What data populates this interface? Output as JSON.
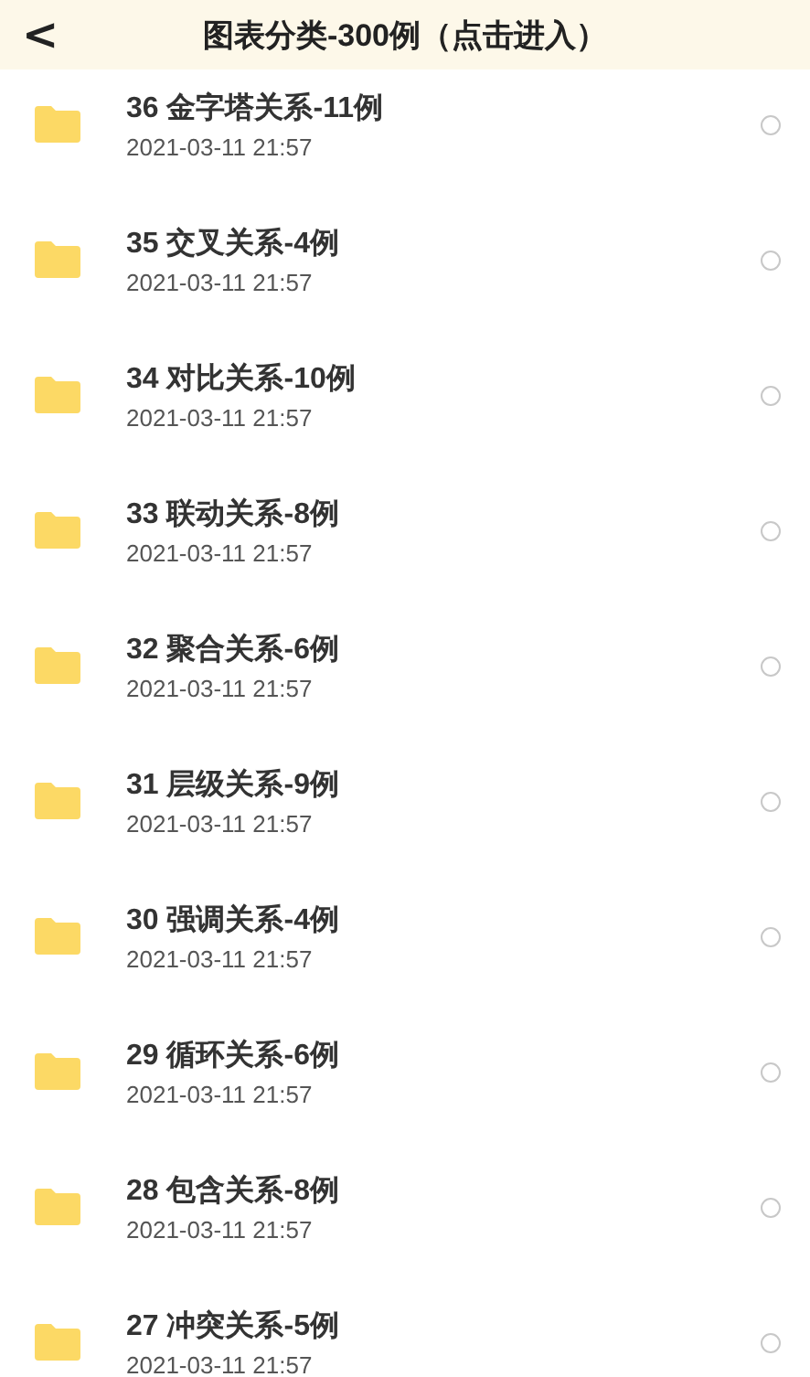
{
  "header": {
    "back": "<",
    "title": "图表分类-300例（点击进入）"
  },
  "items": [
    {
      "title": "36 金字塔关系-11例",
      "date": "2021-03-11 21:57",
      "selected": false
    },
    {
      "title": "35 交叉关系-4例",
      "date": "2021-03-11 21:57",
      "selected": false
    },
    {
      "title": "34 对比关系-10例",
      "date": "2021-03-11 21:57",
      "selected": false
    },
    {
      "title": "33 联动关系-8例",
      "date": "2021-03-11 21:57",
      "selected": false
    },
    {
      "title": "32 聚合关系-6例",
      "date": "2021-03-11 21:57",
      "selected": false
    },
    {
      "title": "31 层级关系-9例",
      "date": "2021-03-11 21:57",
      "selected": false
    },
    {
      "title": "30 强调关系-4例",
      "date": "2021-03-11 21:57",
      "selected": false
    },
    {
      "title": "29 循环关系-6例",
      "date": "2021-03-11 21:57",
      "selected": false
    },
    {
      "title": "28 包含关系-8例",
      "date": "2021-03-11 21:57",
      "selected": false
    },
    {
      "title": "27 冲突关系-5例",
      "date": "2021-03-11 21:57",
      "selected": false
    }
  ]
}
